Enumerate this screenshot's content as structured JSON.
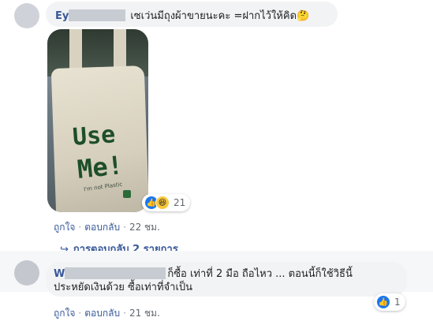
{
  "comment1": {
    "author": "Ey",
    "text": "เซเว่นมีถุงผ้าขายนะคะ =ฝากไว้ให้คิด",
    "emoji": "🤔",
    "photo": {
      "line1": "Use",
      "line2": "Me!",
      "small": "I'm not Plastic"
    },
    "reactions": {
      "count": "21",
      "types": [
        "like-icon",
        "haha-icon"
      ]
    },
    "actions": {
      "like": "ถูกใจ",
      "reply": "ตอบกลับ",
      "time": "22 ชม."
    }
  },
  "view_replies": {
    "label": "การตอบกลับ 2 รายการ"
  },
  "comment2": {
    "author": "W",
    "text_line1": "ก็ซื้อ เท่าที่ 2 มือ ถือไหว ... ตอนนี้ก็ใช้วิธีนี้",
    "text_line2": "ประหยัดเงินด้วย ซื้อเท่าที่จำเป็น",
    "reactions": {
      "count": "1",
      "types": [
        "like-icon"
      ]
    },
    "actions": {
      "like": "ถูกใจ",
      "reply": "ตอบกลับ",
      "time": "21 ชม."
    }
  },
  "colors": {
    "link": "#385898",
    "bubble": "#f2f3f5",
    "like": "#1877f2"
  }
}
